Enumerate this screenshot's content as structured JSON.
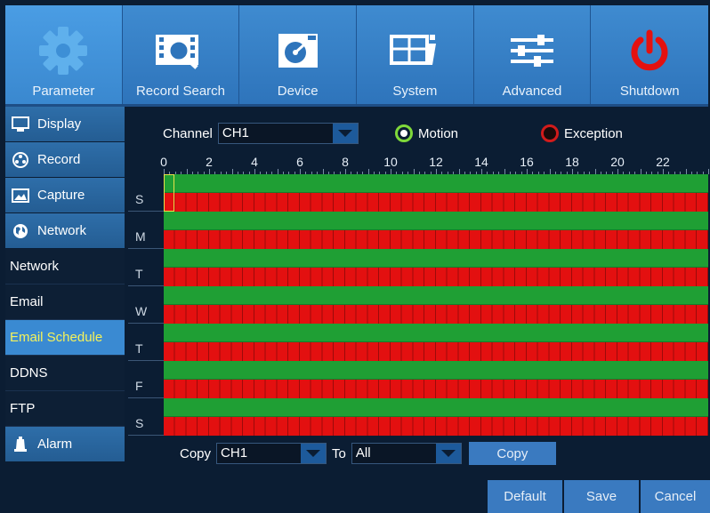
{
  "topbar": {
    "items": [
      {
        "label": "Parameter",
        "icon": "gear-icon"
      },
      {
        "label": "Record Search",
        "icon": "film-search-icon"
      },
      {
        "label": "Device",
        "icon": "hard-disk-icon"
      },
      {
        "label": "System",
        "icon": "system-info-icon"
      },
      {
        "label": "Advanced",
        "icon": "sliders-icon"
      },
      {
        "label": "Shutdown",
        "icon": "power-icon"
      }
    ]
  },
  "sidebar": {
    "items": [
      {
        "label": "Display",
        "icon": "monitor-icon",
        "type": "category"
      },
      {
        "label": "Record",
        "icon": "record-reel-icon",
        "type": "category"
      },
      {
        "label": "Capture",
        "icon": "image-icon",
        "type": "category"
      },
      {
        "label": "Network",
        "icon": "globe-icon",
        "type": "category"
      },
      {
        "label": "Network",
        "type": "sub"
      },
      {
        "label": "Email",
        "type": "sub"
      },
      {
        "label": "Email Schedule",
        "type": "sub",
        "active": true
      },
      {
        "label": "DDNS",
        "type": "sub"
      },
      {
        "label": "FTP",
        "type": "sub"
      },
      {
        "label": "Alarm",
        "icon": "alarm-bell-icon",
        "type": "category"
      }
    ]
  },
  "schedule": {
    "channel_label": "Channel",
    "channel_value": "CH1",
    "legend": {
      "motion": "Motion",
      "exception": "Exception"
    },
    "hours": [
      "0",
      "2",
      "4",
      "6",
      "8",
      "10",
      "12",
      "14",
      "16",
      "18",
      "20",
      "22"
    ],
    "days": [
      "S",
      "M",
      "T",
      "W",
      "T",
      "F",
      "S"
    ],
    "colors": {
      "motion": "#1f9f34",
      "exception": "#e31010",
      "selection": "#e7e14a"
    }
  },
  "copy": {
    "label": "Copy",
    "from_value": "CH1",
    "to_label": "To",
    "to_value": "All",
    "button": "Copy"
  },
  "buttons": {
    "default": "Default",
    "save": "Save",
    "cancel": "Cancel"
  }
}
